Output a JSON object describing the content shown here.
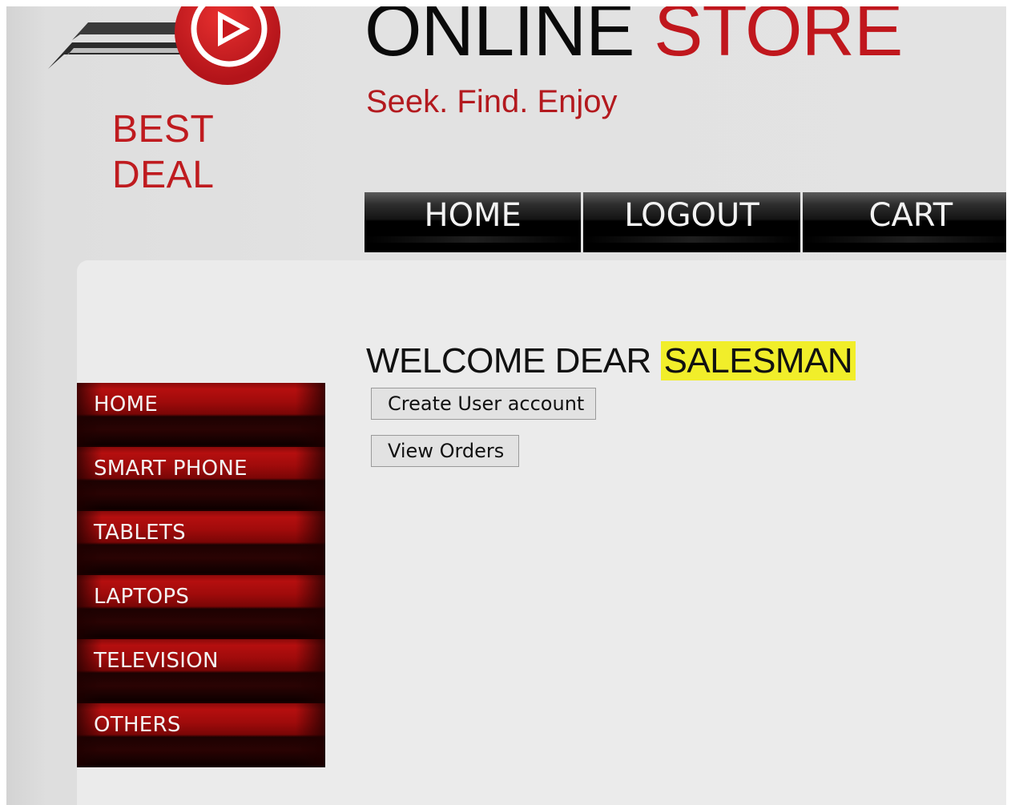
{
  "brand": {
    "logo_line1": "BEST",
    "logo_line2": "DEAL",
    "title_part1": "ONLINE",
    "title_part2": "STORE",
    "tagline": "Seek. Find. Enjoy",
    "colors": {
      "brand_red": "#c0171d",
      "nav_black": "#000000",
      "highlight": "#f1ee2a"
    }
  },
  "top_nav": {
    "items": [
      {
        "label": "HOME"
      },
      {
        "label": "LOGOUT"
      },
      {
        "label": "CART"
      }
    ]
  },
  "welcome": {
    "prefix": "WELCOME DEAR",
    "role": "SALESMAN"
  },
  "actions": {
    "create_user_label": "Create User account",
    "view_orders_label": "View Orders"
  },
  "side_nav": {
    "items": [
      {
        "label": "HOME"
      },
      {
        "label": "SMART PHONE"
      },
      {
        "label": "TABLETS"
      },
      {
        "label": "LAPTOPS"
      },
      {
        "label": "TELEVISION"
      },
      {
        "label": "OTHERS"
      }
    ]
  }
}
